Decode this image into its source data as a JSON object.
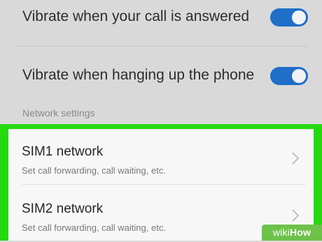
{
  "settings": {
    "toggles": [
      {
        "label": "Vibrate when your call is answered",
        "state": "on"
      },
      {
        "label": "Vibrate when hanging up the phone",
        "state": "on"
      }
    ],
    "section_header": "Network settings",
    "network_items": [
      {
        "title": "SIM1 network",
        "subtitle": "Set call forwarding, call waiting, etc."
      },
      {
        "title": "SIM2 network",
        "subtitle": "Set call forwarding, call waiting, etc."
      }
    ]
  },
  "watermark": {
    "part1": "wiki",
    "part2": "How"
  },
  "colors": {
    "toggle_on": "#1f6ec8",
    "highlight_frame": "#25d90f",
    "background": "#d9d9d9"
  },
  "icons": {
    "chevron": "chevron-right-icon"
  }
}
